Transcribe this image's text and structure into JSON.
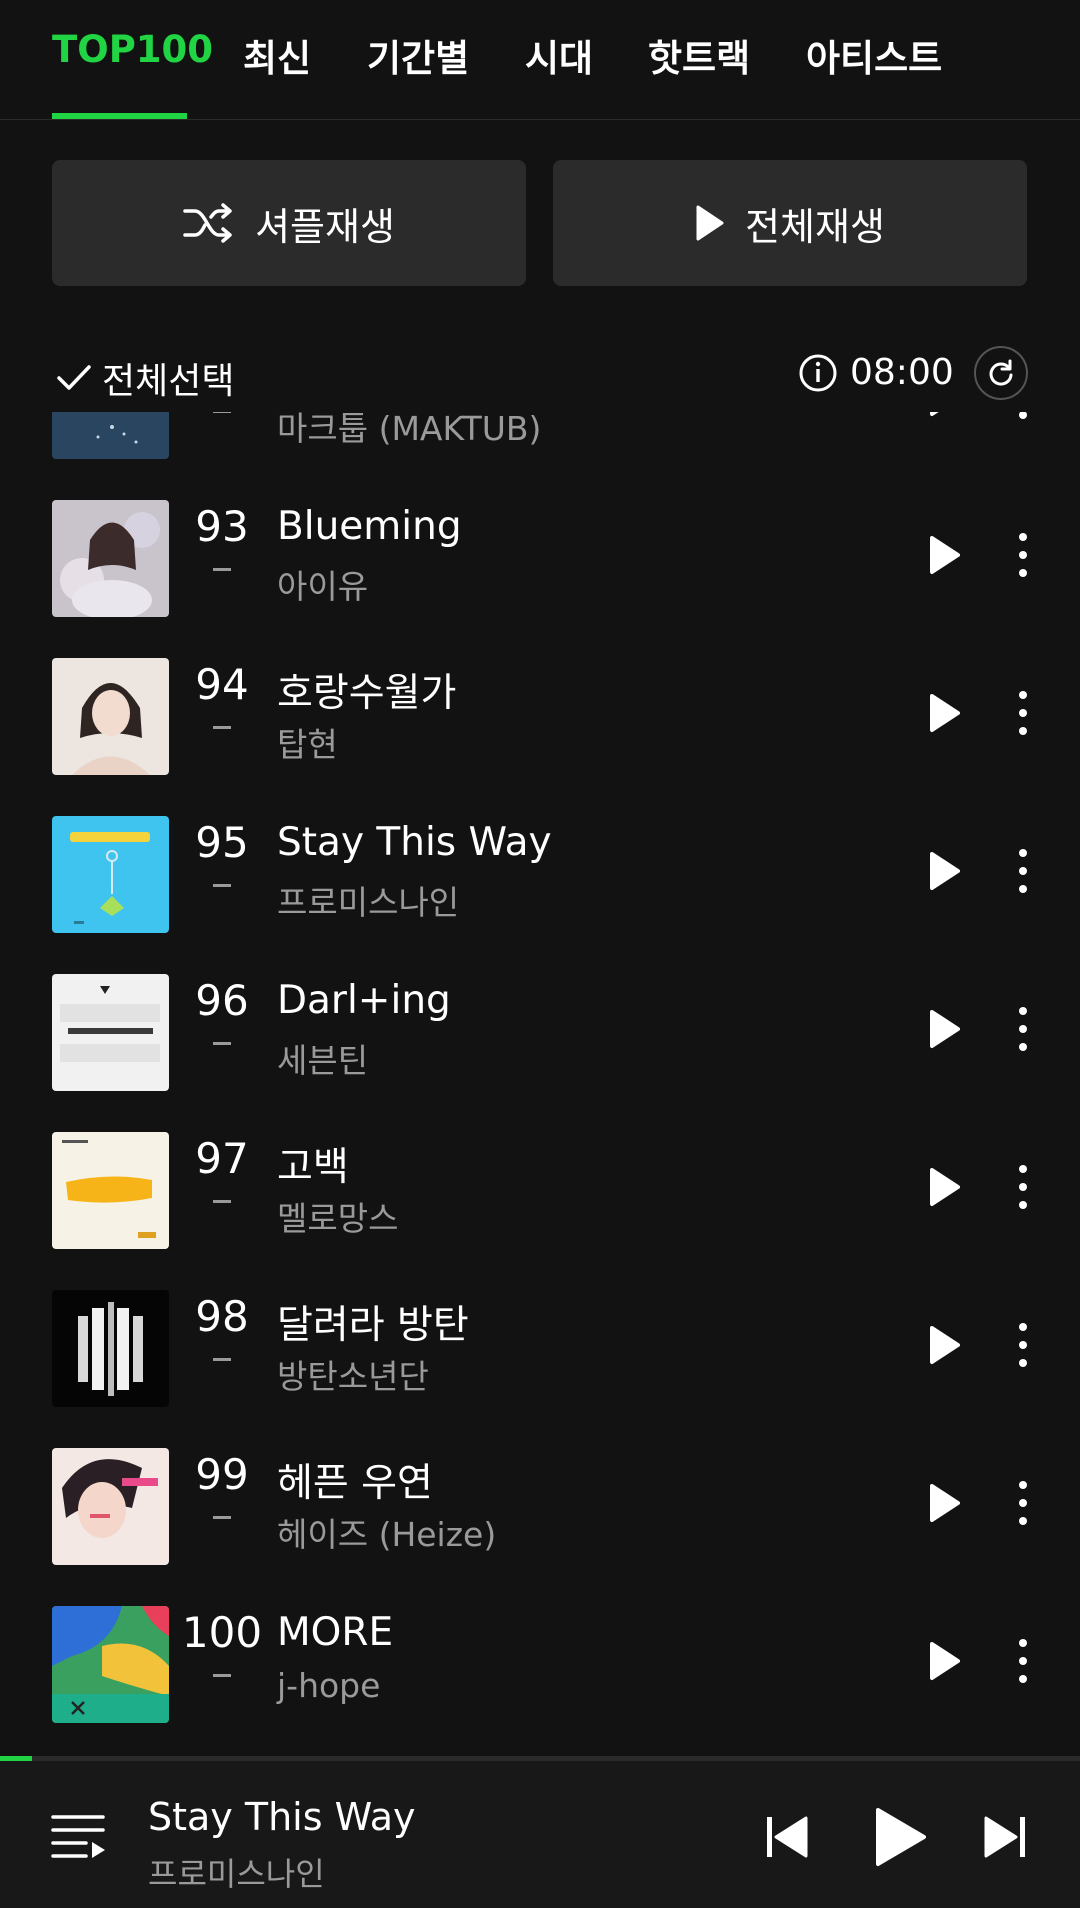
{
  "tabs": [
    {
      "label": "TOP100",
      "active": true
    },
    {
      "label": "최신",
      "active": false
    },
    {
      "label": "기간별",
      "active": false
    },
    {
      "label": "시대",
      "active": false
    },
    {
      "label": "핫트랙",
      "active": false
    },
    {
      "label": "아티스트",
      "active": false
    }
  ],
  "actions": {
    "shuffle_label": "셔플재생",
    "play_all_label": "전체재생"
  },
  "select_bar": {
    "select_all_label": "전체선택",
    "time": "08:00"
  },
  "songs": [
    {
      "rank": "",
      "change": "-",
      "title": "",
      "artist": "마크툽 (MAKTUB)",
      "cover_icon": "album-cover-night-sea"
    },
    {
      "rank": "93",
      "change": "-",
      "title": "Blueming",
      "artist": "아이유",
      "cover_icon": "album-cover-portrait-floral"
    },
    {
      "rank": "94",
      "change": "-",
      "title": "호랑수월가",
      "artist": "탑현",
      "cover_icon": "album-cover-portrait"
    },
    {
      "rank": "95",
      "change": "-",
      "title": "Stay This Way",
      "artist": "프로미스나인",
      "cover_icon": "album-cover-memento-box"
    },
    {
      "rank": "96",
      "change": "-",
      "title": "Darl+ing",
      "artist": "세븐틴",
      "cover_icon": "album-cover-face-the-sun"
    },
    {
      "rank": "97",
      "change": "-",
      "title": "고백",
      "artist": "멜로망스",
      "cover_icon": "album-cover-yellow-stroke"
    },
    {
      "rank": "98",
      "change": "-",
      "title": "달려라 방탄",
      "artist": "방탄소년단",
      "cover_icon": "album-cover-proof"
    },
    {
      "rank": "99",
      "change": "-",
      "title": "헤픈 우연",
      "artist": "헤이즈 (Heize)",
      "cover_icon": "album-cover-happen"
    },
    {
      "rank": "100",
      "change": "-",
      "title": "MORE",
      "artist": "j-hope",
      "cover_icon": "album-cover-more"
    }
  ],
  "now_playing": {
    "title": "Stay This Way",
    "artist": "프로미스나인",
    "progress": 0.03
  },
  "colors": {
    "accent": "#21d444",
    "background": "#121212",
    "button_bg": "#2b2b2b",
    "secondary_text": "#9a9a9a"
  }
}
